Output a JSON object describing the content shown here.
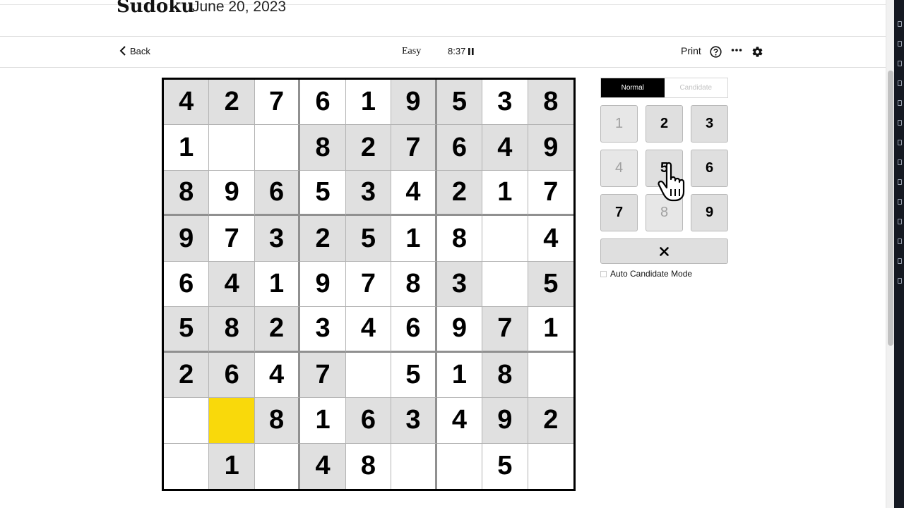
{
  "header": {
    "title": "Sudoku",
    "date": "June 20, 2023"
  },
  "toolbar": {
    "back_label": "Back",
    "difficulty": "Easy",
    "timer": "8:37",
    "print_label": "Print"
  },
  "board": {
    "rows": [
      [
        "4",
        "2",
        "7",
        "6",
        "1",
        "9",
        "5",
        "3",
        "8"
      ],
      [
        "1",
        "",
        "",
        "8",
        "2",
        "7",
        "6",
        "4",
        "9"
      ],
      [
        "8",
        "9",
        "6",
        "5",
        "3",
        "4",
        "2",
        "1",
        "7"
      ],
      [
        "9",
        "7",
        "3",
        "2",
        "5",
        "1",
        "8",
        "",
        "4"
      ],
      [
        "6",
        "4",
        "1",
        "9",
        "7",
        "8",
        "3",
        "",
        "5"
      ],
      [
        "5",
        "8",
        "2",
        "3",
        "4",
        "6",
        "9",
        "7",
        "1"
      ],
      [
        "2",
        "6",
        "4",
        "7",
        "",
        "5",
        "1",
        "8",
        ""
      ],
      [
        "",
        "",
        "8",
        "1",
        "6",
        "3",
        "4",
        "9",
        "2"
      ],
      [
        "",
        "1",
        "",
        "4",
        "8",
        "",
        "",
        "5",
        ""
      ]
    ],
    "given": [
      [
        1,
        1,
        0,
        0,
        0,
        1,
        1,
        0,
        1
      ],
      [
        0,
        0,
        0,
        1,
        1,
        1,
        1,
        1,
        1
      ],
      [
        1,
        0,
        1,
        0,
        1,
        0,
        1,
        0,
        0
      ],
      [
        1,
        0,
        1,
        1,
        1,
        0,
        0,
        0,
        0
      ],
      [
        0,
        1,
        0,
        0,
        0,
        0,
        1,
        0,
        1
      ],
      [
        1,
        1,
        1,
        0,
        0,
        0,
        0,
        1,
        0
      ],
      [
        1,
        1,
        0,
        1,
        0,
        0,
        0,
        1,
        0
      ],
      [
        0,
        0,
        1,
        0,
        1,
        1,
        0,
        1,
        1
      ],
      [
        0,
        1,
        0,
        1,
        0,
        0,
        0,
        0,
        0
      ]
    ],
    "selected": {
      "row": 7,
      "col": 1
    }
  },
  "controls": {
    "mode_normal": "Normal",
    "mode_candidate": "Candidate",
    "active_mode": "Normal",
    "numbers": [
      {
        "label": "1",
        "disabled": true
      },
      {
        "label": "2",
        "disabled": false
      },
      {
        "label": "3",
        "disabled": false
      },
      {
        "label": "4",
        "disabled": true
      },
      {
        "label": "5",
        "disabled": false
      },
      {
        "label": "6",
        "disabled": false
      },
      {
        "label": "7",
        "disabled": false
      },
      {
        "label": "8",
        "disabled": true
      },
      {
        "label": "9",
        "disabled": false
      }
    ],
    "auto_candidate_label": "Auto Candidate Mode",
    "auto_candidate_checked": false
  },
  "colors": {
    "selected_cell": "#f9d90b",
    "given_cell": "#e0e0e0",
    "active_mode_bg": "#000000"
  }
}
